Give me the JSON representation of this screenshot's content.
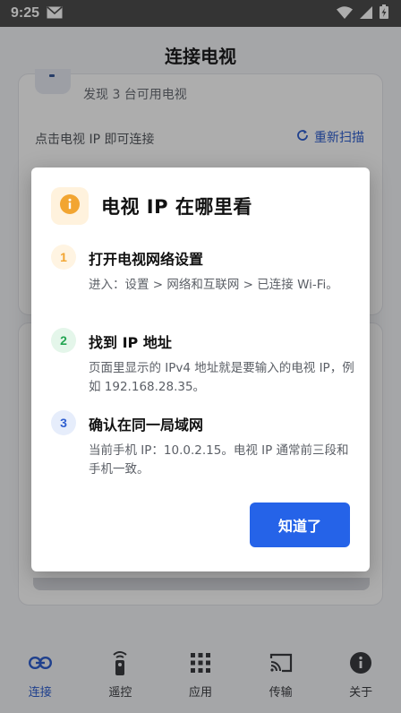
{
  "status_bar": {
    "time": "9:25",
    "icons": [
      "mail-icon",
      "wifi-icon",
      "signal-icon",
      "battery-charging-icon"
    ]
  },
  "header": {
    "title": "连接电视"
  },
  "scan_card": {
    "found_text": "发现 3 台可用电视",
    "hint_text": "点击电视 IP 即可连接",
    "rescan_label": "重新扫描"
  },
  "dialog": {
    "title": "电视 IP 在哪里看",
    "steps": [
      {
        "num": "1",
        "title": "打开电视网络设置",
        "desc": "进入：设置 > 网络和互联网 > 已连接 Wi-Fi。",
        "color": "#f2a531",
        "bg": "#fff4e2"
      },
      {
        "num": "2",
        "title": "找到 IP 地址",
        "desc": "页面里显示的 IPv4 地址就是要输入的电视 IP，例如 192.168.28.35。",
        "color": "#23a552",
        "bg": "#e4f6ea"
      },
      {
        "num": "3",
        "title": "确认在同一局域网",
        "desc": "当前手机 IP：10.0.2.15。电视 IP 通常前三段和手机一致。",
        "color": "#2f5fd0",
        "bg": "#e6edfb"
      }
    ],
    "confirm_label": "知道了"
  },
  "bottom_nav": {
    "items": [
      {
        "label": "连接",
        "icon": "link-icon",
        "active": true
      },
      {
        "label": "遥控",
        "icon": "remote-icon",
        "active": false
      },
      {
        "label": "应用",
        "icon": "grid-icon",
        "active": false
      },
      {
        "label": "传输",
        "icon": "cast-icon",
        "active": false
      },
      {
        "label": "关于",
        "icon": "info-icon",
        "active": false
      }
    ]
  },
  "colors": {
    "accent": "#2563e8",
    "warning": "#f2a531"
  }
}
